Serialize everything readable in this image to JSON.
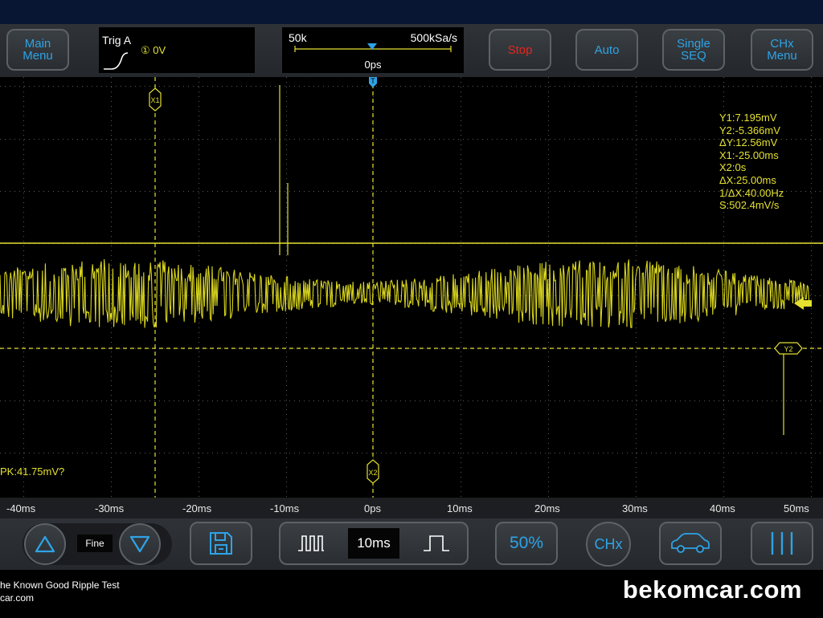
{
  "toolbar": {
    "main_menu": "Main\nMenu",
    "trigger_label": "Trig A",
    "trigger_value": "① 0V",
    "memory_depth": "50k",
    "sample_rate": "500kSa/s",
    "time_offset": "0ps",
    "stop": "Stop",
    "auto": "Auto",
    "single_seq": "Single\nSEQ",
    "chx_menu": "CHx\nMenu"
  },
  "colors": {
    "trace": "#e4e030",
    "accent": "#2ea3e6",
    "stop": "#e3261f"
  },
  "screen": {
    "measurements": [
      "Y1:7.195mV",
      "Y2:-5.366mV",
      "ΔY:12.56mV",
      "X1:-25.00ms",
      "X2:0s",
      "ΔX:25.00ms",
      "1/ΔX:40.00Hz",
      "S:502.4mV/s"
    ],
    "pk_readout": "PK:41.75mV?",
    "cursor_labels": {
      "x1": "X1",
      "x2": "X2",
      "y2": "Y2",
      "trigger": "T"
    }
  },
  "x_axis": [
    "-40ms",
    "-30ms",
    "-20ms",
    "-10ms",
    "0ps",
    "10ms",
    "20ms",
    "30ms",
    "40ms",
    "50ms"
  ],
  "bottombar": {
    "fine_label": "Fine",
    "timebase": "10ms",
    "fifty_percent": "50%",
    "chx": "CHx"
  },
  "footer": {
    "caption": "he Known Good Ripple Test",
    "caption_url": "car.com",
    "brand": "bekomcar.com"
  }
}
